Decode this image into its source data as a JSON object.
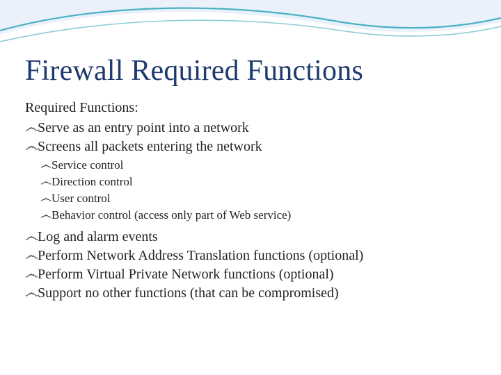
{
  "title": "Firewall Required Functions",
  "subtitle": "Required Functions:",
  "bullet_glyph": "෴",
  "bullets_top": [
    "Serve as an entry point into a network",
    "Screens all packets entering the network"
  ],
  "sub_bullets": [
    "Service control",
    "Direction control",
    "User control",
    "Behavior control (access only part of Web service)"
  ],
  "bullets_bottom": [
    "Log and alarm events",
    "Perform Network Address Translation functions (optional)",
    "Perform Virtual Private Network functions (optional)",
    "Support no other functions (that can be compromised)"
  ]
}
